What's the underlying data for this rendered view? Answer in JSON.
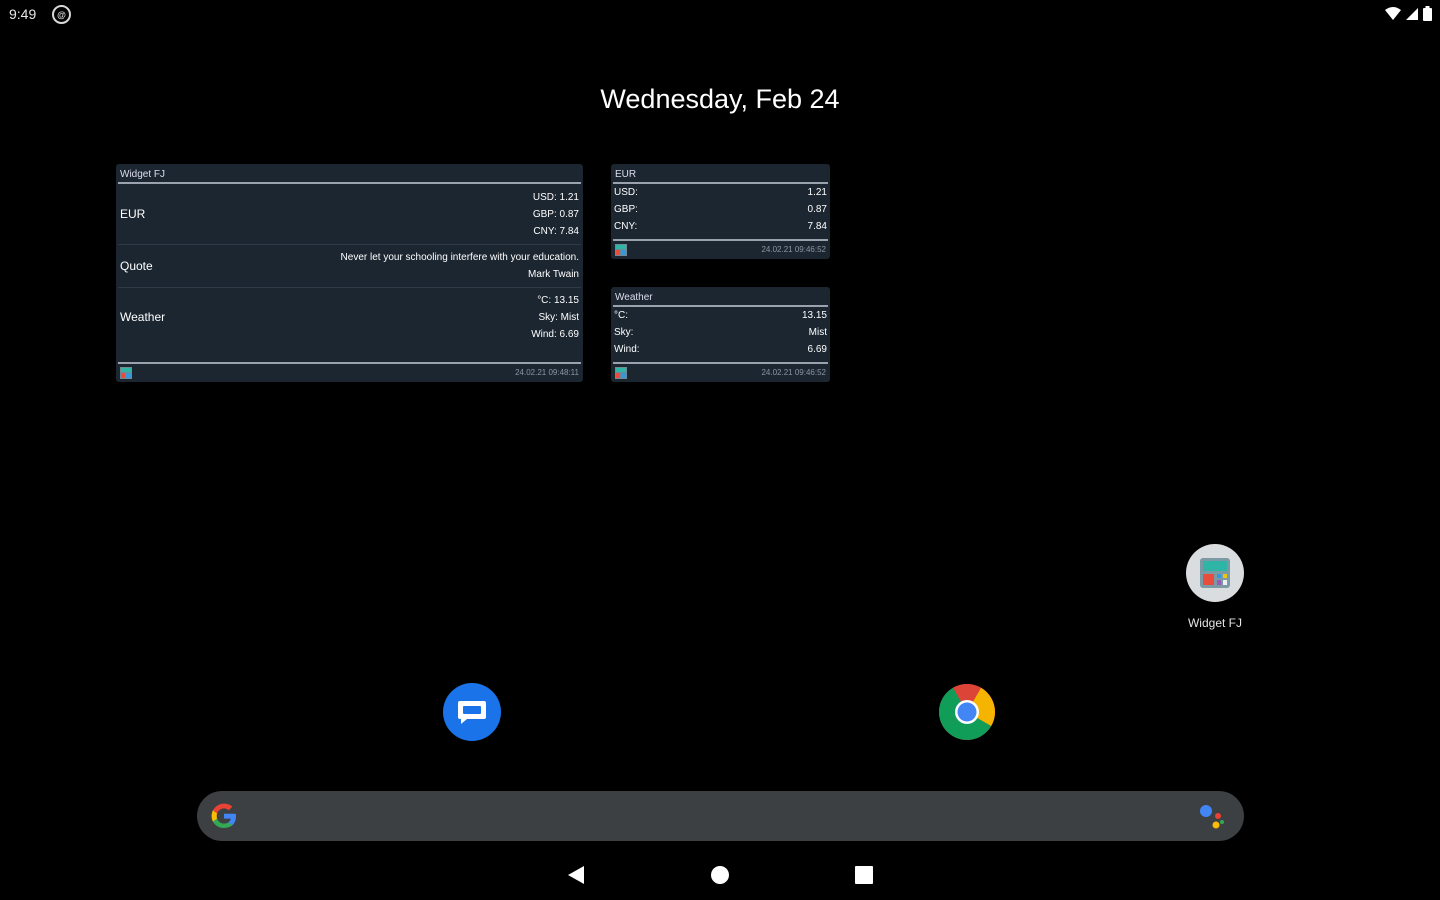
{
  "status_bar": {
    "time": "9:49",
    "notification": "@"
  },
  "home": {
    "date": "Wednesday, Feb 24"
  },
  "widget_main": {
    "title": "Widget FJ",
    "rows": [
      {
        "label": "EUR",
        "values": [
          "USD: 1.21",
          "GBP: 0.87",
          "CNY: 7.84"
        ]
      },
      {
        "label": "Quote",
        "values": [
          "Never let your schooling interfere with your education.",
          "Mark Twain"
        ]
      },
      {
        "label": "Weather",
        "values": [
          "°C: 13.15",
          "Sky: Mist",
          "Wind: 6.69"
        ]
      }
    ],
    "timestamp": "24.02.21 09:48:11"
  },
  "widget_eur": {
    "title": "EUR",
    "items": [
      {
        "key": "USD:",
        "value": "1.21"
      },
      {
        "key": "GBP:",
        "value": "0.87"
      },
      {
        "key": "CNY:",
        "value": "7.84"
      }
    ],
    "timestamp": "24.02.21 09:46:52"
  },
  "widget_weather": {
    "title": "Weather",
    "items": [
      {
        "key": "°C:",
        "value": "13.15"
      },
      {
        "key": "Sky:",
        "value": "Mist"
      },
      {
        "key": "Wind:",
        "value": "6.69"
      }
    ],
    "timestamp": "24.02.21 09:46:52"
  },
  "app_shortcut": {
    "label": "Widget FJ",
    "icon": "widget-fj-icon"
  },
  "dock": {
    "left_icon": "messages-icon",
    "right_icon": "chrome-icon"
  },
  "search": {
    "logo": "google-g-icon",
    "mic": "assistant-icon"
  },
  "nav": {
    "back": "back-icon",
    "home": "home-icon",
    "recents": "recents-icon"
  },
  "colors": {
    "widget_bg": "#1b2631",
    "search_bg": "#3c4043",
    "accent_blue": "#1a73e8"
  }
}
